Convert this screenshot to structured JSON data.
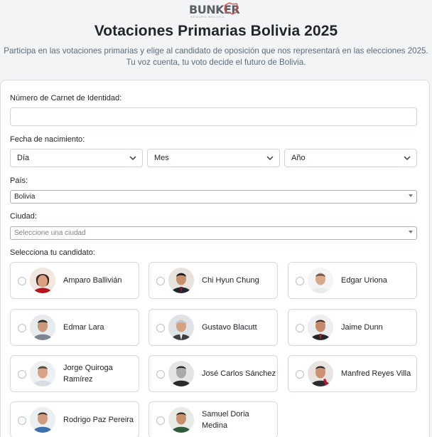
{
  "brand": {
    "logo_text": "BUNKER",
    "logo_subtext": "SEGURO BOLIVIA"
  },
  "header": {
    "title": "Votaciones Primarias Bolivia 2025",
    "subtitle_line1": "Participa en las votaciones primarias y elige al candidato de oposición que nos representará en las elecciones 2025.",
    "subtitle_line2": "Tu voz cuenta, tu voto decide el futuro de Bolivia."
  },
  "form": {
    "ci_label": "Número de Carnet de Identidad:",
    "ci_value": "",
    "dob_label": "Fecha de nacimiento:",
    "day_value": "Día",
    "month_value": "Mes",
    "year_value": "Año",
    "country_label": "País:",
    "country_value": "Bolivia",
    "city_label": "Ciudad:",
    "city_placeholder": "Seleccione una ciudad",
    "candidates_label": "Selecciona tu candidato:"
  },
  "candidates": [
    {
      "name": "Amparo Ballivián",
      "avatar": "woman-portrait-red"
    },
    {
      "name": "Chi Hyun Chung",
      "avatar": "man-portrait-dark"
    },
    {
      "name": "Edgar Uriona",
      "avatar": "man-portrait-white"
    },
    {
      "name": "Edmar Lara",
      "avatar": "man-portrait-gray"
    },
    {
      "name": "Gustavo Blacutt",
      "avatar": "man-portrait-gray-hair"
    },
    {
      "name": "Jaime Dunn",
      "avatar": "man-portrait-suit"
    },
    {
      "name": "Jorge Quiroga Ramírez",
      "avatar": "man-portrait-light"
    },
    {
      "name": "José Carlos Sánchez",
      "avatar": "man-portrait-bw"
    },
    {
      "name": "Manfred Reyes Villa",
      "avatar": "man-portrait-flag"
    },
    {
      "name": "Rodrigo Paz Pereira",
      "avatar": "man-portrait-blue-shirt"
    },
    {
      "name": "Samuel Doria Medina",
      "avatar": "man-portrait-green"
    }
  ],
  "colors": {
    "title": "#212529",
    "subtitle": "#5b6b7a",
    "border": "#d4d8dd",
    "logo_red": "#d9534f"
  }
}
